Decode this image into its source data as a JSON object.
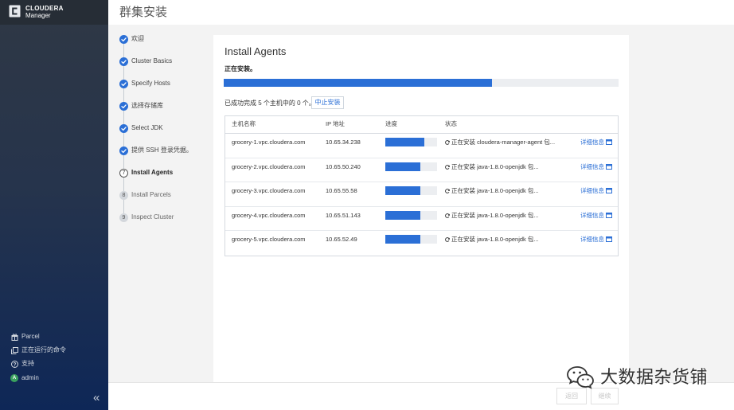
{
  "sidebar": {
    "logo": {
      "brand": "CLOUDERA",
      "product": "Manager",
      "icon": "cloudera-c-icon"
    },
    "bottom_items": [
      {
        "label": "Parcel",
        "icon": "gift-icon"
      },
      {
        "label": "正在运行的命令",
        "icon": "running-commands-icon"
      },
      {
        "label": "支持",
        "icon": "help-icon"
      },
      {
        "label": "admin",
        "icon": "avatar",
        "avatar_letter": "A"
      }
    ],
    "collapse_glyph": "«"
  },
  "header": {
    "title": "群集安装"
  },
  "wizard": {
    "steps": [
      {
        "label": "欢迎",
        "state": "done",
        "icon": "check-circle-icon"
      },
      {
        "label": "Cluster Basics",
        "state": "done",
        "icon": "check-circle-icon"
      },
      {
        "label": "Specify Hosts",
        "state": "done",
        "icon": "check-circle-icon"
      },
      {
        "label": "选择存储库",
        "state": "done",
        "icon": "check-circle-icon"
      },
      {
        "label": "Select JDK",
        "state": "done",
        "icon": "check-circle-icon"
      },
      {
        "label": "提供 SSH 登录凭据。",
        "state": "done",
        "icon": "check-circle-icon"
      },
      {
        "label": "Install Agents",
        "state": "current",
        "number": "7"
      },
      {
        "label": "Install Parcels",
        "state": "pending",
        "number": "8"
      },
      {
        "label": "Inspect Cluster",
        "state": "pending",
        "number": "9"
      }
    ]
  },
  "main": {
    "title": "Install Agents",
    "status_text": "正在安装。",
    "overall_progress": 0.68,
    "summary_text": "已成功完成 5 个主机中的 0 个。",
    "abort_button": "中止安装",
    "table": {
      "columns": [
        "主机名称",
        "IP 地址",
        "进度",
        "状态"
      ],
      "rows": [
        {
          "host": "grocery-1.vpc.cloudera.com",
          "ip": "10.65.34.238",
          "progress": 0.75,
          "status": "正在安装 cloudera-manager-agent 包...",
          "details_label": "详细信息"
        },
        {
          "host": "grocery-2.vpc.cloudera.com",
          "ip": "10.65.50.240",
          "progress": 0.68,
          "status": "正在安装 java-1.8.0-openjdk 包...",
          "details_label": "详细信息"
        },
        {
          "host": "grocery-3.vpc.cloudera.com",
          "ip": "10.65.55.58",
          "progress": 0.68,
          "status": "正在安装 java-1.8.0-openjdk 包...",
          "details_label": "详细信息"
        },
        {
          "host": "grocery-4.vpc.cloudera.com",
          "ip": "10.65.51.143",
          "progress": 0.68,
          "status": "正在安装 java-1.8.0-openjdk 包...",
          "details_label": "详细信息"
        },
        {
          "host": "grocery-5.vpc.cloudera.com",
          "ip": "10.65.52.49",
          "progress": 0.68,
          "status": "正在安装 java-1.8.0-openjdk 包...",
          "details_label": "详细信息"
        }
      ]
    }
  },
  "footer": {
    "back_label": "返回",
    "continue_label": "继续"
  },
  "watermark": {
    "text": "大数据杂货铺",
    "icon": "wechat-icon"
  },
  "colors": {
    "accent": "#2b6fd6",
    "sidebar_top": "#2f3845",
    "sidebar_bottom": "#0e2757",
    "page_bg": "#f3f3f3",
    "avatar": "#3aa15e",
    "disabled": "#c6c6c6"
  }
}
